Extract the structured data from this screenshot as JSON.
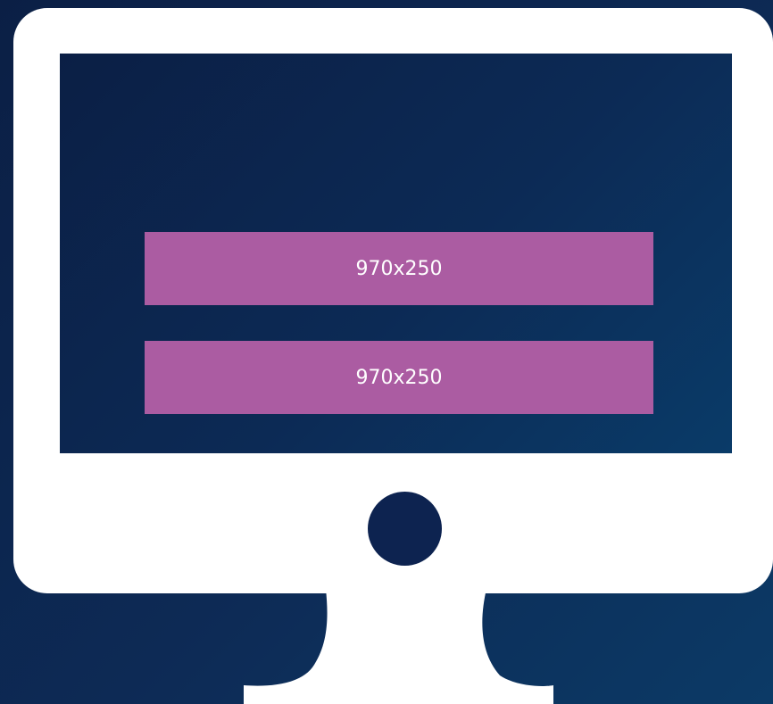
{
  "ads": [
    {
      "label": "970x250"
    },
    {
      "label": "970x250"
    }
  ],
  "colors": {
    "background": "#0b1f45",
    "bezel": "#ffffff",
    "ad_slot": "#ab5ca2",
    "power_button": "#0d2350"
  },
  "icons": {
    "device": "desktop-monitor-icon",
    "button": "power-button-icon"
  }
}
